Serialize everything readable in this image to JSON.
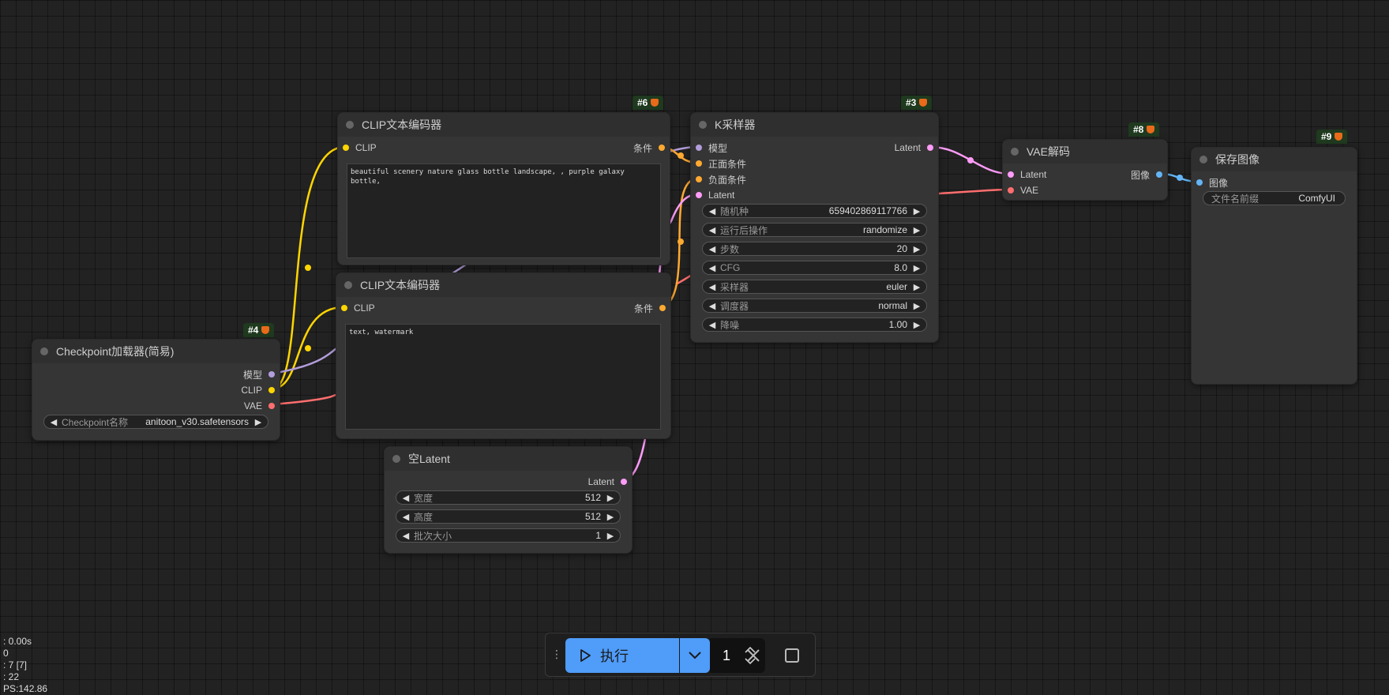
{
  "nodes": {
    "clip_text_1": {
      "badge": "#6",
      "title": "CLIP文本编码器",
      "input_clip": "CLIP",
      "output_cond": "条件",
      "text": "beautiful scenery nature glass bottle landscape, , purple galaxy bottle,"
    },
    "clip_text_2": {
      "title": "CLIP文本编码器",
      "input_clip": "CLIP",
      "output_cond": "条件",
      "text": "text, watermark"
    },
    "checkpoint": {
      "badge": "#4",
      "title": "Checkpoint加载器(简易)",
      "out_model": "模型",
      "out_clip": "CLIP",
      "out_vae": "VAE",
      "widget_label": "Checkpoint名称",
      "widget_value": "anitoon_v30.safetensors"
    },
    "empty_latent": {
      "title": "空Latent",
      "out_latent": "Latent",
      "width_label": "宽度",
      "width_value": "512",
      "height_label": "高度",
      "height_value": "512",
      "batch_label": "批次大小",
      "batch_value": "1"
    },
    "ksampler": {
      "badge": "#3",
      "title": "K采样器",
      "in_model": "模型",
      "in_positive": "正面条件",
      "in_negative": "负面条件",
      "in_latent": "Latent",
      "out_latent": "Latent",
      "widgets": [
        {
          "label": "随机种",
          "value": "659402869117766"
        },
        {
          "label": "运行后操作",
          "value": "randomize"
        },
        {
          "label": "步数",
          "value": "20"
        },
        {
          "label": "CFG",
          "value": "8.0"
        },
        {
          "label": "采样器",
          "value": "euler"
        },
        {
          "label": "调度器",
          "value": "normal"
        },
        {
          "label": "降噪",
          "value": "1.00"
        }
      ]
    },
    "vae_decode": {
      "badge": "#8",
      "title": "VAE解码",
      "in_latent": "Latent",
      "in_vae": "VAE",
      "out_image": "图像"
    },
    "save_image": {
      "badge": "#9",
      "title": "保存图像",
      "in_image": "图像",
      "widget_label": "文件名前缀",
      "widget_value": "ComfyUI"
    }
  },
  "toolbar": {
    "run_label": "执行",
    "batch_count": "1"
  },
  "stats": {
    "line1": ": 0.00s",
    "line2": "0",
    "line3": ": 7 [7]",
    "line4": ": 22",
    "line5": "PS:142.86"
  },
  "colors": {
    "model": "#b39ddb",
    "clip": "#ffd500",
    "vae": "#ff6e6e",
    "conditioning": "#ffa931",
    "latent": "#ff9cf9",
    "image": "#64b5f6",
    "run_button": "#4f9cf9",
    "badge_bg": "#1f3a1f"
  }
}
